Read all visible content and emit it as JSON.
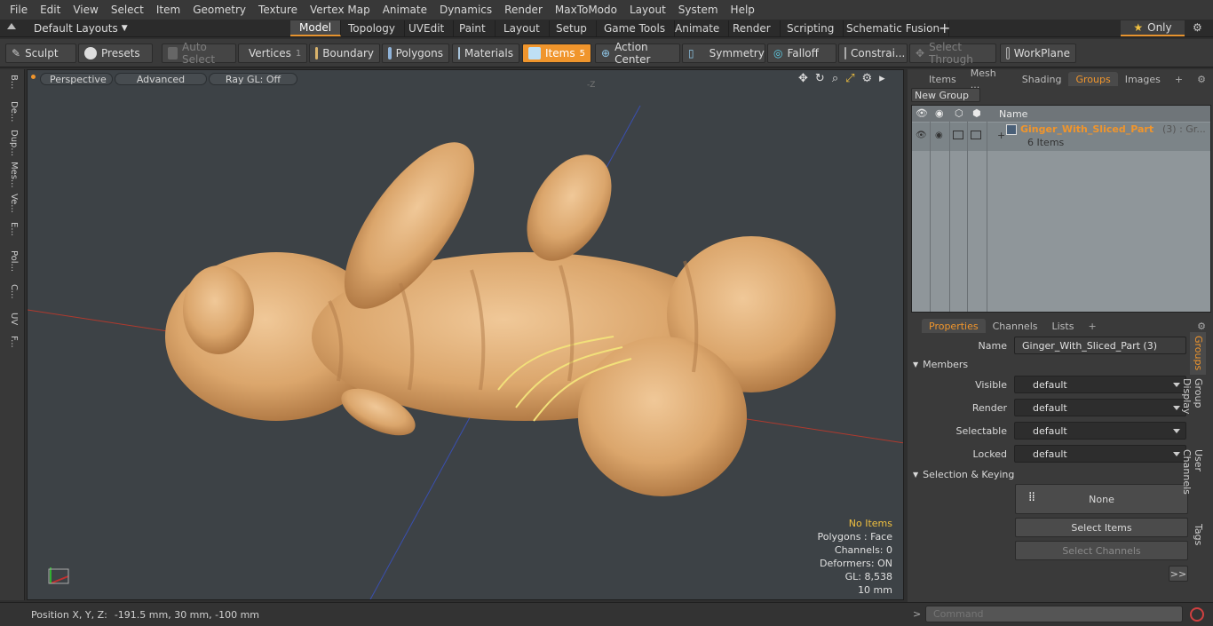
{
  "menu": [
    "File",
    "Edit",
    "View",
    "Select",
    "Item",
    "Geometry",
    "Texture",
    "Vertex Map",
    "Animate",
    "Dynamics",
    "Render",
    "MaxToModo",
    "Layout",
    "System",
    "Help"
  ],
  "layout_selector": "Default Layouts",
  "mode_tabs": [
    "Model",
    "Topology",
    "UVEdit",
    "Paint",
    "Layout",
    "Setup",
    "Game Tools",
    "Animate",
    "Render",
    "Scripting",
    "Schematic Fusion"
  ],
  "active_mode_tab": "Model",
  "only_label": "Only",
  "toolbar": {
    "sculpt": "Sculpt",
    "presets": "Presets",
    "auto_select": "Auto Select",
    "vertices": "Vertices",
    "vertices_count": "1",
    "boundary": "Boundary",
    "polygons": "Polygons",
    "materials": "Materials",
    "items": "Items",
    "items_count": "5",
    "action_center": "Action Center",
    "symmetry": "Symmetry",
    "falloff": "Falloff",
    "constraints": "Constrai...",
    "select_through": "Select Through",
    "workplane": "WorkPlane"
  },
  "left_strip_tabs": [
    "B...",
    "De...",
    "Dup...",
    "Mes...",
    "Ve...",
    "E...",
    "Pol...",
    "C...",
    "UV",
    "F..."
  ],
  "viewport": {
    "view_mode": "Perspective",
    "shading": "Advanced",
    "raygl": "Ray GL: Off",
    "axis_label": "-Z",
    "hud": {
      "no_items": "No Items",
      "polygons": "Polygons : Face",
      "channels": "Channels: 0",
      "deformers": "Deformers: ON",
      "gl": "GL: 8,538",
      "scale": "10 mm"
    }
  },
  "status": {
    "position_label": "Position X, Y, Z:",
    "position_value": "-191.5 mm, 30 mm, -100 mm"
  },
  "right_top_tabs": [
    "Items",
    "Mesh ...",
    "Shading",
    "Groups",
    "Images"
  ],
  "active_top_tab": "Groups",
  "new_group": "New Group",
  "group_list": {
    "col_name": "Name",
    "group_name": "Ginger_With_Sliced_Part",
    "group_suffix": "(3) : Gr...",
    "group_items": "6 Items"
  },
  "right_bottom_tabs": [
    "Properties",
    "Channels",
    "Lists"
  ],
  "active_bottom_tab": "Properties",
  "properties": {
    "name_label": "Name",
    "name_value": "Ginger_With_Sliced_Part (3)",
    "members_section": "Members",
    "visible_label": "Visible",
    "visible_value": "default",
    "render_label": "Render",
    "render_value": "default",
    "selectable_label": "Selectable",
    "selectable_value": "default",
    "locked_label": "Locked",
    "locked_value": "default",
    "selection_section": "Selection & Keying",
    "none_btn": "None",
    "select_items": "Select Items",
    "select_channels": "Select Channels",
    "more_btn": ">>"
  },
  "side_vertical_tabs": [
    "Groups",
    "Group Display",
    "User Channels",
    "Tags"
  ],
  "command_placeholder": "Command",
  "colors": {
    "accent": "#f0952c",
    "viewport_bg": "#3d4246",
    "ginger": "#d9a26a"
  }
}
